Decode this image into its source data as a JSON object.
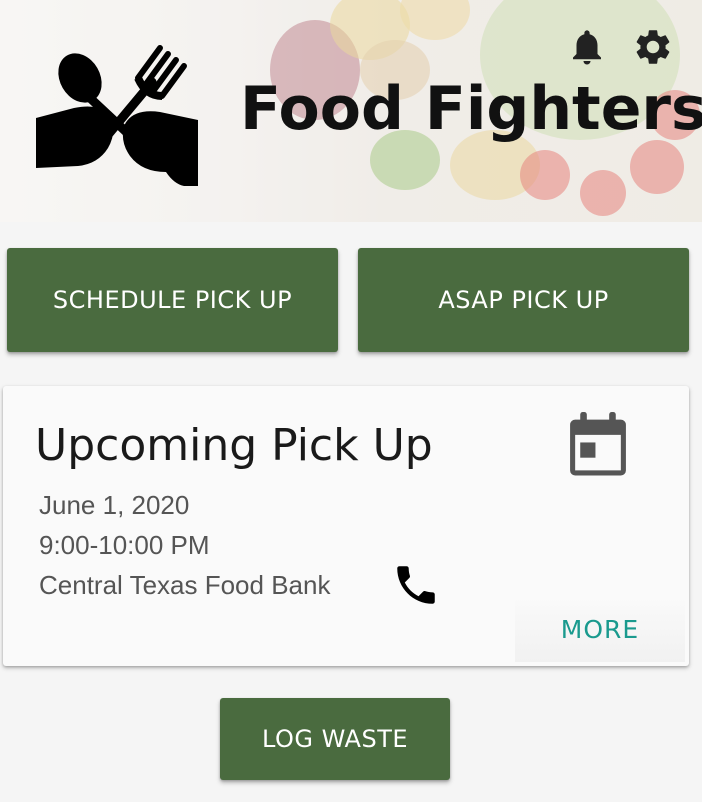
{
  "header": {
    "app_title": "Food Fighters",
    "icons": [
      "notifications-bell-icon",
      "settings-gear-icon"
    ]
  },
  "actions": {
    "schedule_label": "SCHEDULE PICK UP",
    "asap_label": "ASAP PICK UP",
    "log_waste_label": "LOG WASTE"
  },
  "upcoming": {
    "title": "Upcoming Pick Up",
    "date": "June 1, 2020",
    "time": "9:00-10:00 PM",
    "location": "Central Texas Food Bank",
    "more_label": "MORE",
    "icons": [
      "calendar-icon",
      "phone-icon"
    ]
  },
  "colors": {
    "primary_button": "#4a6b3f",
    "accent_link": "#1a9a8e",
    "background": "#f5f5f5"
  }
}
